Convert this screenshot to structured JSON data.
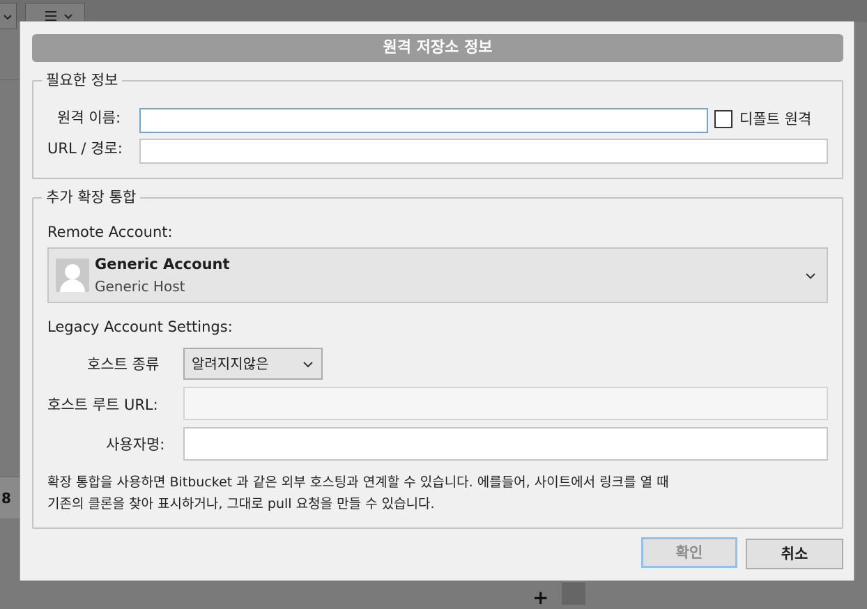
{
  "background": {
    "fragment_number": "8",
    "plus_glyph": "+"
  },
  "dialog": {
    "title": "원격 저장소 정보",
    "required_group": {
      "legend": "필요한 정보",
      "remote_name_label": "원격 이름:",
      "remote_name_value": "",
      "url_label": "URL / 경로:",
      "url_value": "",
      "default_remote_label": "디폴트 원격",
      "default_remote_checked": false
    },
    "integration_group": {
      "legend": "추가 확장 통합",
      "remote_account_label": "Remote Account:",
      "account": {
        "name": "Generic Account",
        "host": "Generic Host",
        "icon": "user-avatar-icon"
      },
      "legacy_label": "Legacy Account Settings:",
      "host_type_label": "호스트 종류",
      "host_type_value": "알려지지않은",
      "host_root_url_label": "호스트 루트 URL:",
      "host_root_url_value": "",
      "username_label": "사용자명:",
      "username_value": "",
      "description_line1": "확장 통합을 사용하면 Bitbucket 과 같은 외부 호스팅과 연계할 수 있습니다. 에를들어, 사이트에서 링크를 열 때",
      "description_line2": "기존의 클론을 찾아 표시하거나, 그대로 pull 요청을 만들 수 있습니다."
    },
    "buttons": {
      "ok": "확인",
      "cancel": "취소"
    }
  },
  "colors": {
    "title_bar": "#9b9b9b",
    "focus_border": "#6ea6d8",
    "dialog_bg": "#f0f0f0"
  }
}
